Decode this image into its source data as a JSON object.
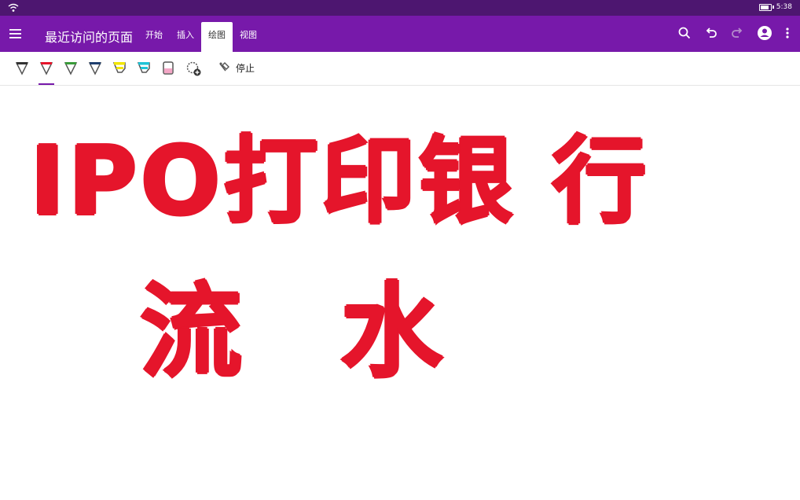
{
  "status_bar": {
    "time": "5:38"
  },
  "app_bar": {
    "page_title": "最近访问的页面",
    "tabs": [
      {
        "label": "开始"
      },
      {
        "label": "插入"
      },
      {
        "label": "绘图",
        "active": true
      },
      {
        "label": "视图"
      }
    ],
    "accent_color": "#7719aa"
  },
  "ribbon": {
    "tools": [
      {
        "icon": "pen-black-icon",
        "color": "#333333"
      },
      {
        "icon": "pen-red-icon",
        "color": "#e5152b",
        "selected": true
      },
      {
        "icon": "pen-green-icon",
        "color": "#3a9b3a"
      },
      {
        "icon": "pen-navy-icon",
        "color": "#1f3f6e"
      },
      {
        "icon": "highlighter-yellow-icon",
        "color": "#f2e600"
      },
      {
        "icon": "highlighter-cyan-icon",
        "color": "#1fc3d6"
      },
      {
        "icon": "highlighter-pink-icon",
        "color": "#f4a6c6"
      },
      {
        "icon": "add-pen-icon"
      }
    ],
    "stop_label": "停止"
  },
  "canvas": {
    "ink_color": "#e5152b",
    "lines": [
      "IPO打印银 行",
      "流 水"
    ]
  }
}
